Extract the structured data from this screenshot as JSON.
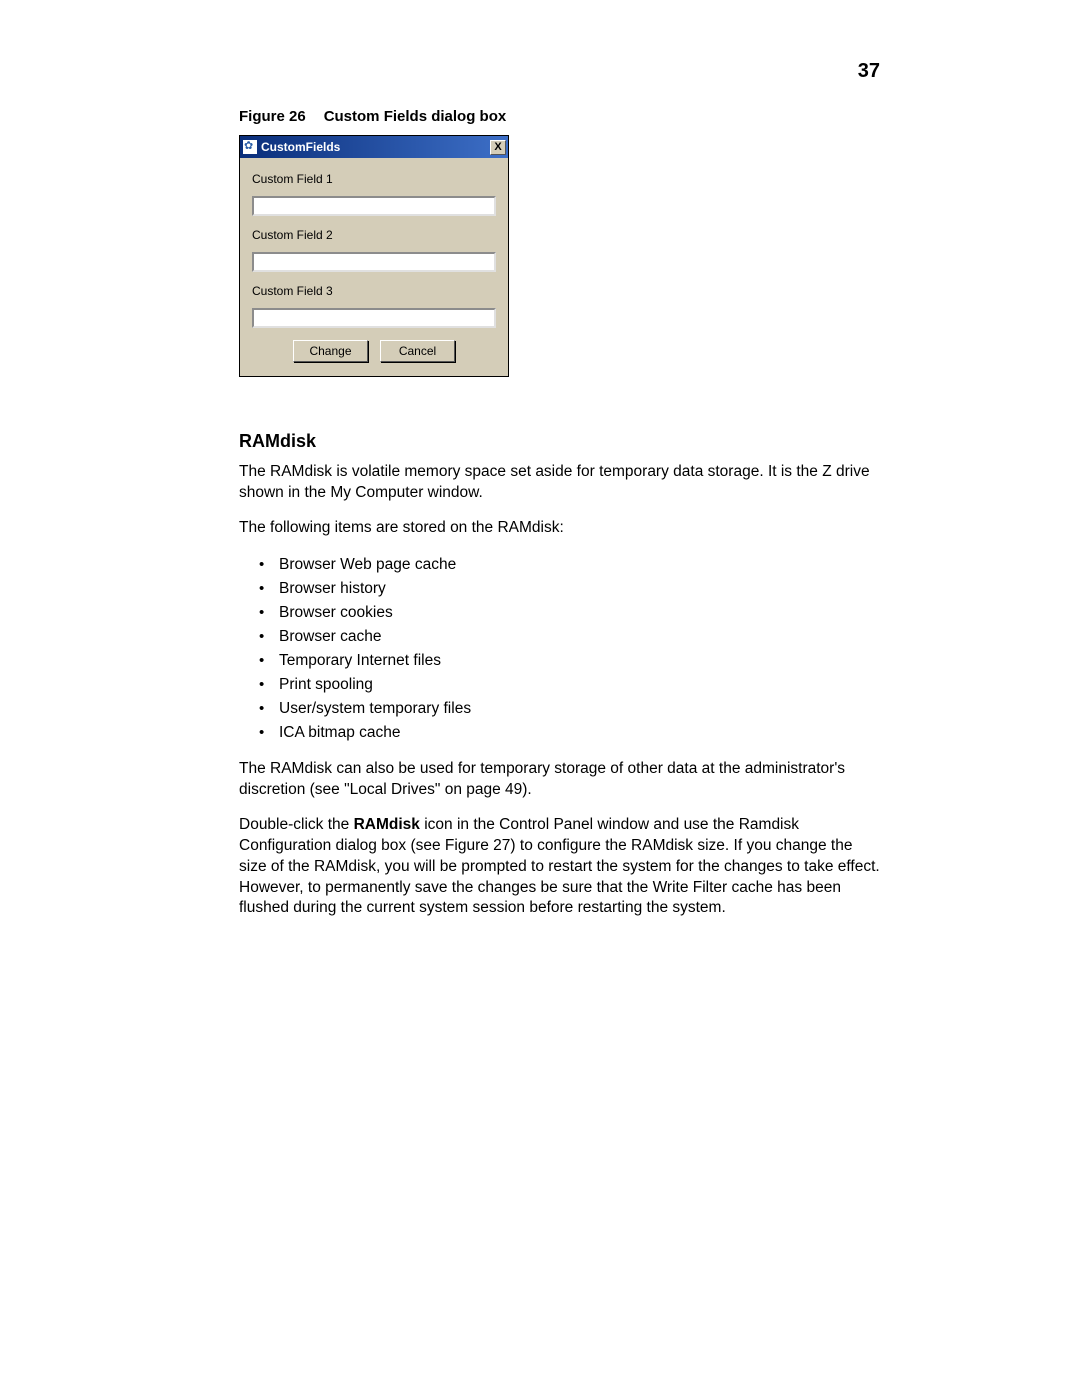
{
  "page_number": "37",
  "figure": {
    "label": "Figure 26",
    "title": "Custom Fields dialog box"
  },
  "dialog": {
    "title": "CustomFields",
    "close_label": "X",
    "fields": [
      {
        "label": "Custom Field 1",
        "value": ""
      },
      {
        "label": "Custom Field 2",
        "value": ""
      },
      {
        "label": "Custom Field 3",
        "value": ""
      }
    ],
    "buttons": {
      "change": "Change",
      "cancel": "Cancel"
    }
  },
  "section": {
    "heading": "RAMdisk",
    "para1": "The RAMdisk is volatile memory space set aside for temporary data storage. It is the Z drive shown in the My Computer window.",
    "para2": "The following items are stored on the RAMdisk:",
    "list": [
      "Browser Web page cache",
      "Browser history",
      "Browser cookies",
      "Browser cache",
      "Temporary Internet files",
      "Print spooling",
      "User/system temporary files",
      "ICA bitmap cache"
    ],
    "para3": "The RAMdisk can also be used for temporary storage of other data at the administrator's discretion (see \"Local Drives\" on page 49).",
    "para4_pre": "Double-click the ",
    "para4_bold": "RAMdisk",
    "para4_post": " icon in the Control Panel window and use the Ramdisk Configuration dialog box (see Figure 27) to configure the RAMdisk size. If you change the size of the RAMdisk, you will be prompted to restart the system for the changes to take effect. However, to permanently save the changes be sure that the Write Filter cache has been flushed during the current system session before restarting the system."
  }
}
